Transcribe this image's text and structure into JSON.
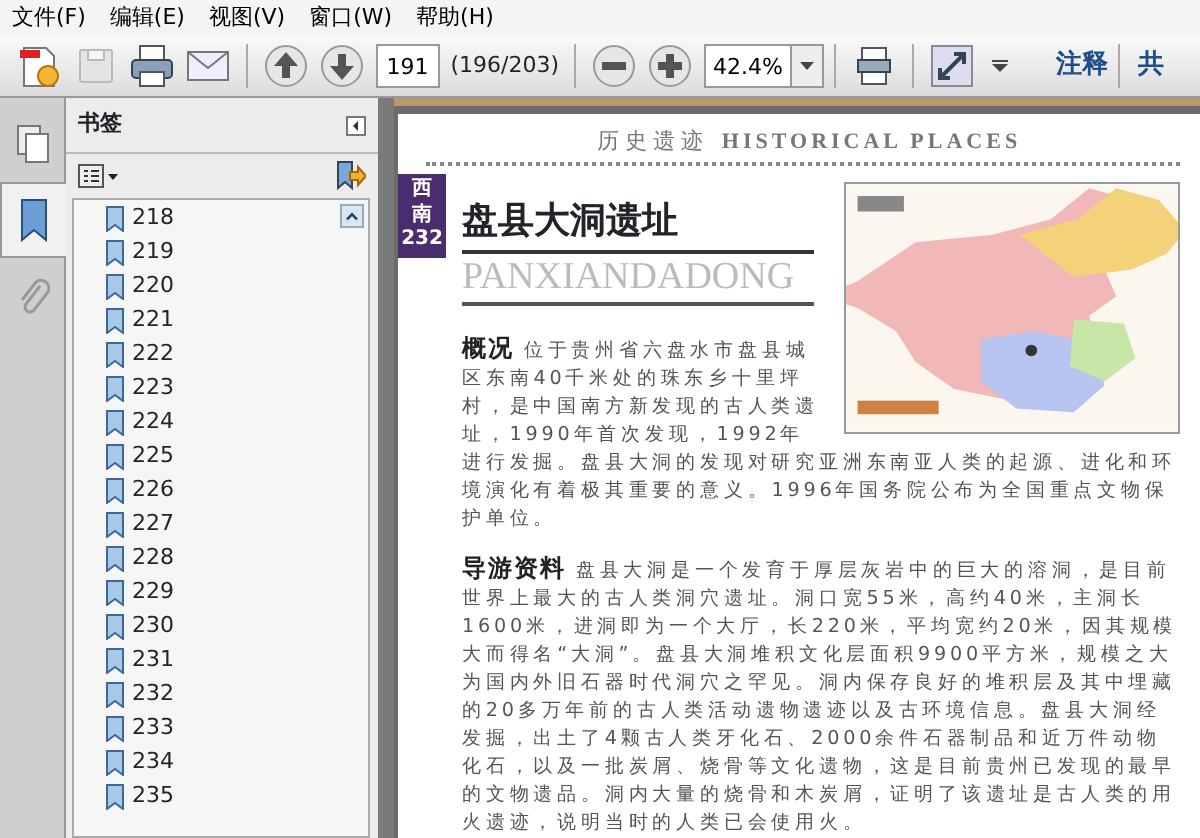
{
  "menu": [
    {
      "label": "文件(F)"
    },
    {
      "label": "编辑(E)"
    },
    {
      "label": "视图(V)"
    },
    {
      "label": "窗口(W)"
    },
    {
      "label": "帮助(H)"
    }
  ],
  "toolbar": {
    "page_field": "191",
    "page_count": "(196/203)",
    "zoom_field": "42.4%",
    "comment_label": "注释",
    "cut_label": "共"
  },
  "side_tabs": [
    {
      "kind": "pages",
      "selected": false
    },
    {
      "kind": "bookmarks",
      "selected": true
    },
    {
      "kind": "attachments",
      "selected": false
    }
  ],
  "bookmarks_panel": {
    "title": "书签",
    "items": [
      "218",
      "219",
      "220",
      "221",
      "222",
      "223",
      "224",
      "225",
      "226",
      "227",
      "228",
      "229",
      "230",
      "231",
      "232",
      "233",
      "234",
      "235"
    ]
  },
  "document": {
    "header_cn": "历史遗迹",
    "header_en": "HISTORICAL PLACES",
    "region_tab": "西南",
    "page_number": "232",
    "title": "盘县大洞遗址",
    "title_pinyin": "PANXIANDADONG",
    "sections": [
      {
        "text": "**概况** 位于贵州省六盘水市盘县城区东南40千米处的珠东乡十里坪村，是中国南方新发现的古人类遗址，1990年首次发现，1992年进行发掘。盘县大洞的发现对研究亚洲东南亚人类的起源、进化和环境演化有着极其重要的意义。1996年国务院公布为全国重点文物保护单位。"
      },
      {
        "text": "**导游资料** 盘县大洞是一个发育于厚层灰岩中的巨大的溶洞，是目前世界上最大的古人类洞穴遗址。洞口宽55米，高约40米，主洞长1600米，进洞即为一个大厅，长220米，平均宽约20米，因其规模大而得名“大洞”。盘县大洞堆积文化层面积9900平方米，规模之大为国内外旧石器时代洞穴之罕见。洞内保存良好的堆积层及其中埋藏的20多万年前的古人类活动遗物遗迹以及古环境信息。盘县大洞经发掘，出土了4颗古人类牙化石、2000余件石器制品和近万件动物化石，以及一批炭屑、烧骨等文化遗物，这是目前贵州已发现的最早的文物遗品。洞内大量的烧骨和木炭屑，证明了该遗址是古人类的用火遗迹，说明当时的人类已会使用火。"
      }
    ]
  }
}
